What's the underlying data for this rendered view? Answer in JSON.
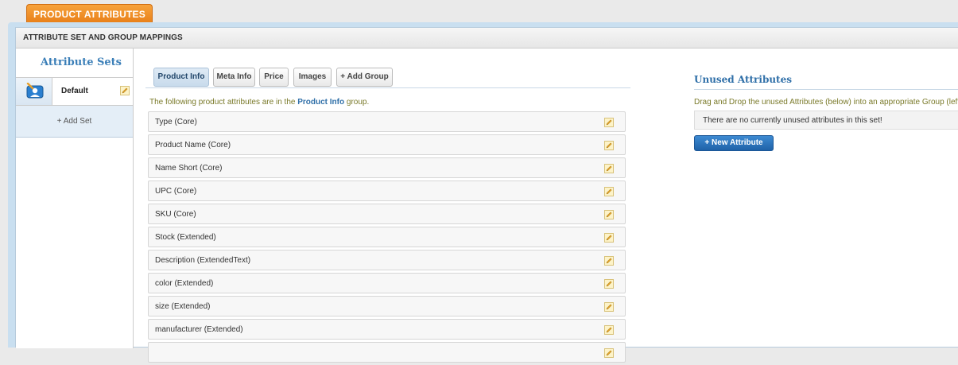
{
  "page": {
    "tab_label": "PRODUCT ATTRIBUTES",
    "header": "ATTRIBUTE SET AND GROUP MAPPINGS"
  },
  "sidebar": {
    "title": "Attribute Sets",
    "sets": [
      {
        "label": "Default",
        "icon": "attribute-set-icon"
      }
    ],
    "add_label": "+ Add Set"
  },
  "groups": {
    "tabs": [
      {
        "label": "Product Info",
        "active": true
      },
      {
        "label": "Meta Info",
        "active": false
      },
      {
        "label": "Price",
        "active": false
      },
      {
        "label": "Images",
        "active": false
      },
      {
        "label": "+ Add Group",
        "active": false
      }
    ],
    "info_prefix": "The following product attributes are in the",
    "info_group": "Product Info",
    "info_suffix": "group.",
    "attributes": [
      "Type (Core)",
      "Product Name (Core)",
      "Name Short (Core)",
      "UPC (Core)",
      "SKU (Core)",
      "Stock (Extended)",
      "Description (ExtendedText)",
      "color (Extended)",
      "size (Extended)",
      "manufacturer (Extended)"
    ]
  },
  "unused": {
    "title": "Unused Attributes",
    "help": "Drag and Drop the unused Attributes (below) into an appropriate Group (left)",
    "empty_message": "There are no currently unused attributes in this set!",
    "new_button": "+ New Attribute"
  },
  "colors": {
    "accent": "#e8801a",
    "link": "#2f6fa8",
    "button": "#1f62a8"
  }
}
